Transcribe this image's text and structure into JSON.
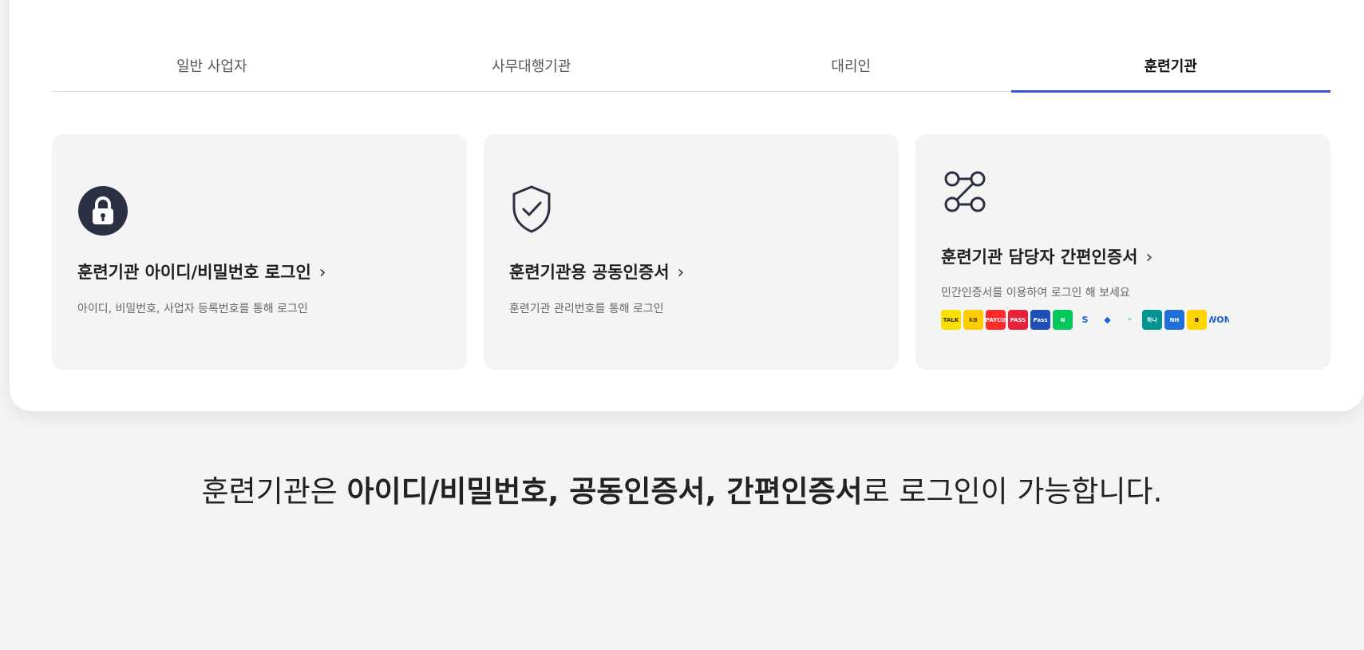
{
  "tabs": [
    {
      "label": "일반 사업자",
      "active": false
    },
    {
      "label": "사무대행기관",
      "active": false
    },
    {
      "label": "대리인",
      "active": false
    },
    {
      "label": "훈련기관",
      "active": true
    }
  ],
  "cards": {
    "id_login": {
      "title": "훈련기관 아이디/비밀번호 로그인",
      "desc": "아이디, 비밀번호, 사업자 등록번호를 통해 로그인",
      "icon": "lock-icon"
    },
    "cert_login": {
      "title": "훈련기관용 공동인증서",
      "desc": "훈련기관 관리번호를 통해 로그인",
      "icon": "shield-check-icon"
    },
    "simple_login": {
      "title": "훈련기관 담당자 간편인증서",
      "desc": "민간인증서를 이용하여 로그인 해 보세요",
      "icon": "connection-icon",
      "providers": [
        {
          "name": "kakao",
          "label": "TALK",
          "bg": "#f9e000",
          "fg": "#3a1d1d"
        },
        {
          "name": "kb",
          "label": "KB",
          "bg": "#ffcc00",
          "fg": "#5a4a00"
        },
        {
          "name": "payco",
          "label": "PAYCO",
          "bg": "#ff2a2a",
          "fg": "#ffffff"
        },
        {
          "name": "pass",
          "label": "PASS",
          "bg": "#e8213a",
          "fg": "#ffffff"
        },
        {
          "name": "samsung-pass",
          "label": "Pass",
          "bg": "#1e4fb5",
          "fg": "#ffffff"
        },
        {
          "name": "naver",
          "label": "N",
          "bg": "#03c75a",
          "fg": "#ffffff"
        },
        {
          "name": "shinhan",
          "label": "S",
          "bg": "#ffffff",
          "fg": "#1f5fd1"
        },
        {
          "name": "toss",
          "label": "◆",
          "bg": "#ffffff",
          "fg": "#1b64da"
        },
        {
          "name": "bank-salad",
          "label": "ᵕ",
          "bg": "#ffffff",
          "fg": "#1bc47d"
        },
        {
          "name": "hana",
          "label": "하나",
          "bg": "#009490",
          "fg": "#ffffff"
        },
        {
          "name": "nh",
          "label": "NH",
          "bg": "#1f6fd6",
          "fg": "#ffffff"
        },
        {
          "name": "banksign",
          "label": "B",
          "bg": "#ffd400",
          "fg": "#111111"
        },
        {
          "name": "woori",
          "label": "WON",
          "bg": "#ffffff",
          "fg": "#1a5bc9"
        }
      ]
    }
  },
  "bottom": {
    "prefix": "훈련기관은 ",
    "strong1": "아이디/비밀번호, 공동인증서, 간편인증서",
    "suffix": "로 로그인이 가능합니다."
  },
  "colors": {
    "accent": "#3a56d4",
    "icon_dark": "#2b3143"
  }
}
